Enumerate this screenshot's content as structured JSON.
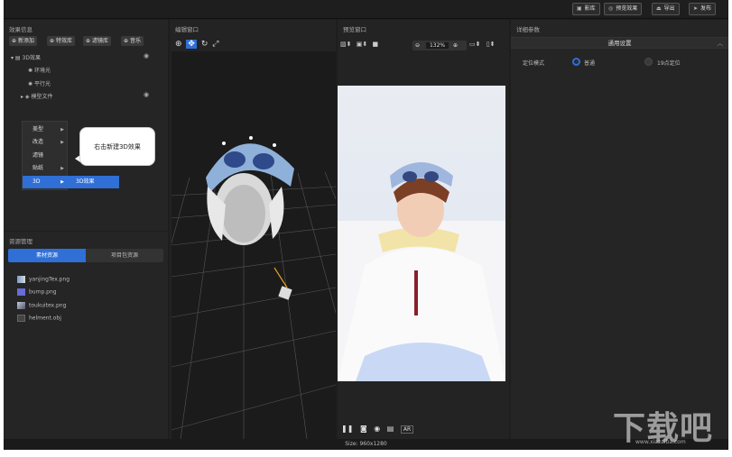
{
  "toolbar": {
    "btn1": "影库",
    "btn2": "预览效果",
    "btn3": "导出",
    "btn4": "发布"
  },
  "effects": {
    "title": "效果信息",
    "chips": [
      "新添加",
      "特效库",
      "滤镜库",
      "音乐"
    ],
    "tree": {
      "root": "3D效果",
      "child1": "环境光",
      "child2": "平行光",
      "child3": "模型文件"
    }
  },
  "context_menu": {
    "items": [
      "美型",
      "改造",
      "滤镜",
      "贴纸",
      "3D"
    ],
    "submenu": "3D效果"
  },
  "callout": "右击新建3D效果",
  "resources": {
    "title": "资源管理",
    "tab_active": "素材资源",
    "tab_inactive": "项目包资源",
    "files": [
      "yanjingTex.png",
      "bump.png",
      "toukuitex.png",
      "helment.obj"
    ]
  },
  "editor": {
    "title": "编辑窗口"
  },
  "preview": {
    "title": "预览窗口",
    "zoom": "132%",
    "bottom_label": "AR"
  },
  "details": {
    "title": "详细参数",
    "section": "通用设置",
    "row_label": "定位模式",
    "opt1": "普通",
    "opt2": "19点定位"
  },
  "status": {
    "size": "Size: 960x1280"
  },
  "colors": {
    "accent": "#2f6fd6",
    "bg": "#1e1e1e",
    "panel": "#252525"
  },
  "watermark": {
    "main": "下载吧",
    "sub": "www.xiazaiba.com"
  }
}
